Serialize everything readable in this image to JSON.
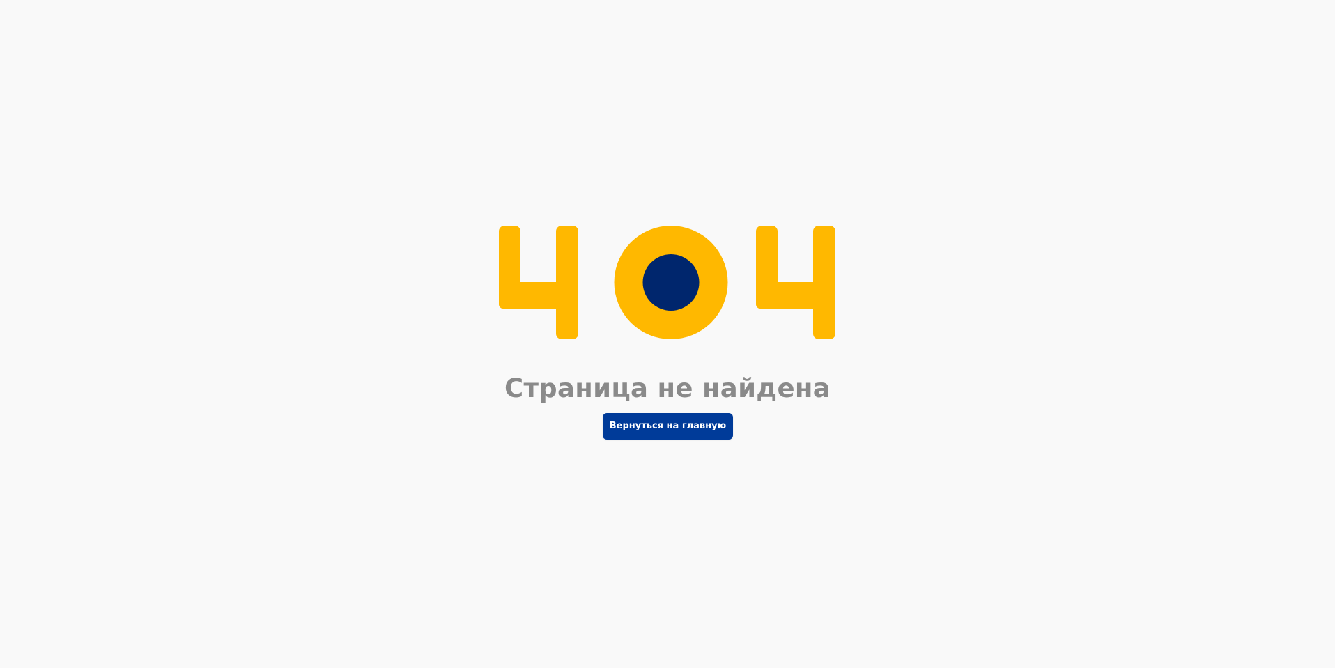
{
  "error_page": {
    "code": "404",
    "title": "Страница не найдена",
    "home_button_label": "Вернуться на главную"
  },
  "colors": {
    "background": "#f9f9f9",
    "accent_yellow": "#ffb800",
    "accent_navy": "#00266d",
    "button": "#003b99",
    "title": "#8a8a8a"
  }
}
